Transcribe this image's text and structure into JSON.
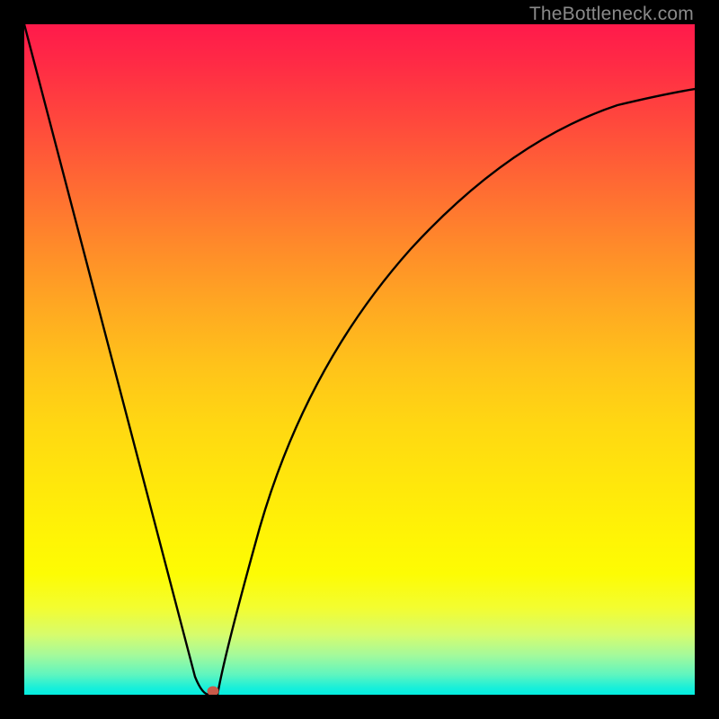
{
  "watermark": "TheBottleneck.com",
  "chart_data": {
    "type": "line",
    "title": "",
    "xlabel": "",
    "ylabel": "",
    "xlim": [
      0,
      100
    ],
    "ylim": [
      0,
      100
    ],
    "x": [
      0,
      5,
      10,
      15,
      20,
      25,
      27,
      30,
      35,
      40,
      45,
      50,
      55,
      60,
      65,
      70,
      75,
      80,
      85,
      90,
      95,
      100
    ],
    "values": [
      100,
      81,
      62,
      44,
      25,
      6,
      0,
      8,
      24,
      38,
      49,
      58,
      65,
      71,
      76,
      80,
      83,
      85,
      87,
      88,
      89,
      90
    ],
    "marker": {
      "x": 27.5,
      "y": 0,
      "color": "#c85a4a"
    },
    "background_gradient": [
      "#ff1a4b",
      "#ffd812",
      "#03eee0"
    ]
  }
}
